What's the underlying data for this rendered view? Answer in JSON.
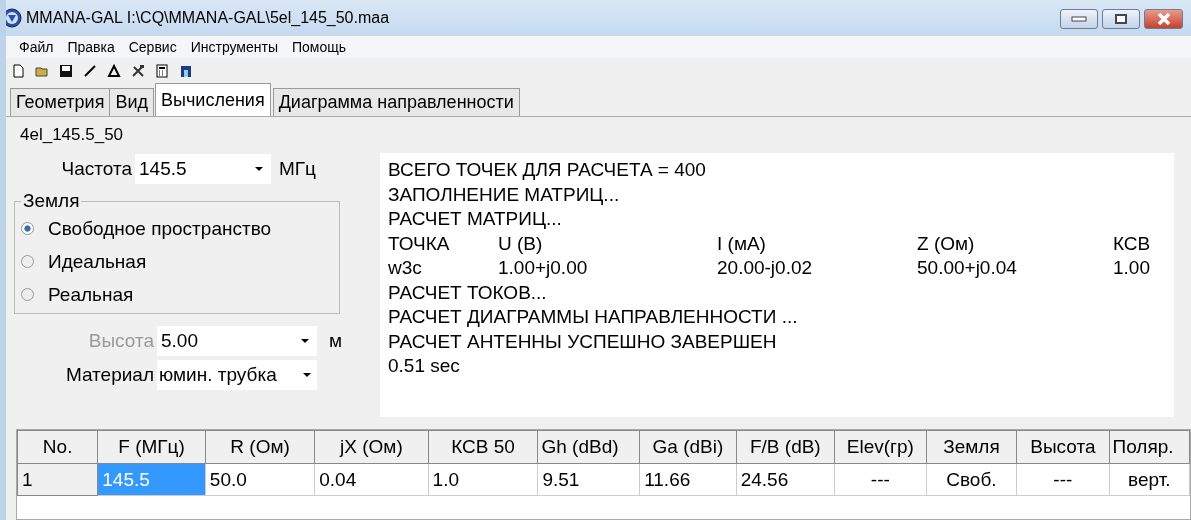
{
  "window": {
    "title": "MMANA-GAL I:\\CQ\\MMANA-GAL\\5el_145_50.maa"
  },
  "menu": [
    "Файл",
    "Правка",
    "Сервис",
    "Инструменты",
    "Помощь"
  ],
  "tabs": [
    {
      "label": "Геометрия",
      "selected": false
    },
    {
      "label": "Вид",
      "selected": false
    },
    {
      "label": "Вычисления",
      "selected": true
    },
    {
      "label": "Диаграмма направленности",
      "selected": false
    }
  ],
  "antenna_name": "4el_145.5_50",
  "frequency": {
    "label": "Частота",
    "value": "145.5",
    "unit": "МГц"
  },
  "ground": {
    "title": "Земля",
    "options": [
      {
        "label": "Свободное пространство",
        "selected": true
      },
      {
        "label": "Идеальная",
        "selected": false
      },
      {
        "label": "Реальная",
        "selected": false
      }
    ]
  },
  "height": {
    "label": "Высота",
    "value": "5.00",
    "unit": "м",
    "disabled": true
  },
  "material": {
    "label": "Материал",
    "value": "юмин. трубка"
  },
  "output": {
    "lines_before": [
      "ВСЕГО ТОЧЕК ДЛЯ РАСЧЕТА = 400",
      "ЗАПОЛНЕНИЕ МАТРИЦ...",
      "РАСЧЕТ МАТРИЦ..."
    ],
    "header": [
      "ТОЧКА",
      "U (В)",
      "I (мА)",
      "Z (Ом)",
      "КСВ"
    ],
    "row": [
      "w3c",
      "1.00+j0.00",
      "20.00-j0.02",
      "50.00+j0.04",
      "1.00"
    ],
    "lines_after": [
      "РАСЧЕТ ТОКОВ...",
      "РАСЧЕТ ДИАГРАММЫ НАПРАВЛЕННОСТИ ...",
      "РАСЧЕТ АНТЕННЫ УСПЕШНО ЗАВЕРШЕН",
      "0.51 sec"
    ]
  },
  "table": {
    "columns": [
      "No.",
      "F (МГц)",
      "R (Ом)",
      "jX (Ом)",
      "КСВ 50",
      "Gh (dBd)",
      "Ga (dBi)",
      "F/B (dB)",
      "Elev(гр)",
      "Земля",
      "Высота",
      "Поляр."
    ],
    "rows": [
      {
        "cells": [
          {
            "text": "1",
            "selected": false
          },
          {
            "text": "145.5",
            "selected": true
          },
          {
            "text": "50.0",
            "selected": false
          },
          {
            "text": "0.04",
            "selected": false
          },
          {
            "text": "1.0",
            "selected": false
          },
          {
            "text": "9.51",
            "selected": false
          },
          {
            "text": "11.66",
            "selected": false
          },
          {
            "text": "24.56",
            "selected": false
          },
          {
            "text": "---",
            "selected": false
          },
          {
            "text": "Своб.",
            "selected": false
          },
          {
            "text": "---",
            "selected": false
          },
          {
            "text": "верт.",
            "selected": false
          }
        ]
      }
    ]
  }
}
